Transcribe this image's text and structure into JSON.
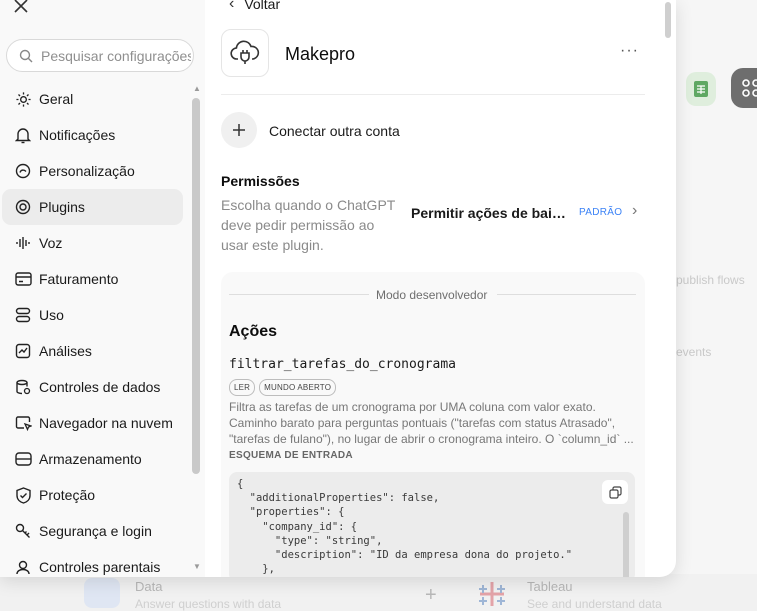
{
  "sidebar": {
    "search_placeholder": "Pesquisar configurações",
    "items": [
      {
        "label": "Geral",
        "icon": "gear-icon",
        "active": false
      },
      {
        "label": "Notificações",
        "icon": "bell-icon",
        "active": false
      },
      {
        "label": "Personalização",
        "icon": "personalization-icon",
        "active": false
      },
      {
        "label": "Plugins",
        "icon": "plugin-icon",
        "active": true
      },
      {
        "label": "Voz",
        "icon": "voice-icon",
        "active": false
      },
      {
        "label": "Faturamento",
        "icon": "card-icon",
        "active": false
      },
      {
        "label": "Uso",
        "icon": "usage-icon",
        "active": false
      },
      {
        "label": "Análises",
        "icon": "chart-icon",
        "active": false
      },
      {
        "label": "Controles de dados",
        "icon": "database-icon",
        "active": false
      },
      {
        "label": "Navegador na nuvem",
        "icon": "browser-icon",
        "active": false
      },
      {
        "label": "Armazenamento",
        "icon": "storage-icon",
        "active": false
      },
      {
        "label": "Proteção",
        "icon": "shield-icon",
        "active": false
      },
      {
        "label": "Segurança e login",
        "icon": "key-icon",
        "active": false
      },
      {
        "label": "Controles parentais",
        "icon": "family-icon",
        "active": false
      }
    ]
  },
  "content": {
    "back_label": "Voltar",
    "plugin_name": "Makepro",
    "more_label": "···",
    "connect_label": "Conectar outra conta",
    "permissions": {
      "title": "Permissões",
      "description": "Escolha quando o ChatGPT deve pedir permissão ao usar este plugin.",
      "value": "Permitir ações de baixo risco",
      "badge": "PADRÃO"
    },
    "dev_mode_label": "Modo desenvolvedor",
    "actions_title": "Ações",
    "action": {
      "name": "filtrar_tarefas_do_cronograma",
      "tags": [
        "LER",
        "MUNDO ABERTO"
      ],
      "description_1": "Filtra as tarefas de um cronograma por UMA coluna com valor exato.",
      "description_2": "Caminho barato para perguntas pontuais (\"tarefas com status Atrasado\",",
      "description_3": "\"tarefas de fulano\"), no lugar de abrir o cronograma inteiro. O `column_id` ...",
      "schema_label": "ESQUEMA DE ENTRADA",
      "schema_code": "{\n  \"additionalProperties\": false,\n  \"properties\": {\n    \"company_id\": {\n      \"type\": \"string\",\n      \"description\": \"ID da empresa dona do projeto.\"\n    },\n    \"project_id\": {"
    }
  },
  "background": {
    "text_publish": "publish flows",
    "text_events": "events",
    "tile1_title": "Data",
    "tile1_sub": "Answer questions with data",
    "tile2_title": "Tableau",
    "tile2_sub": "See and understand data"
  }
}
